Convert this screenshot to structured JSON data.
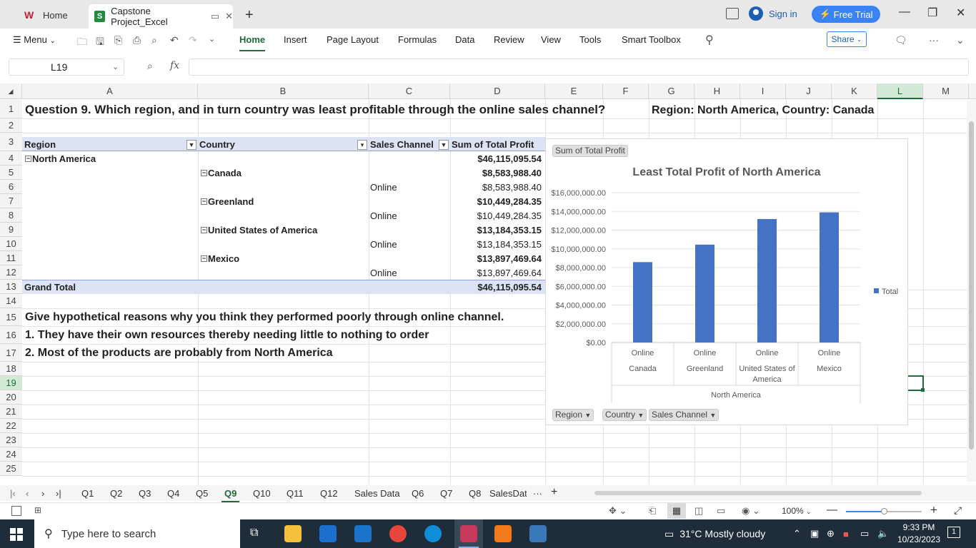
{
  "window": {
    "tabs": [
      {
        "label": "Home"
      },
      {
        "label": "Capstone Project_Excel"
      }
    ],
    "sign_in": "Sign in",
    "free_trial": "Free Trial"
  },
  "menu": {
    "menu_label": "Menu",
    "items": [
      "Home",
      "Insert",
      "Page Layout",
      "Formulas",
      "Data",
      "Review",
      "View",
      "Tools",
      "Smart Toolbox"
    ],
    "share": "Share"
  },
  "formula_bar": {
    "cell_ref": "L19",
    "fx": "fx",
    "value": ""
  },
  "columns": [
    "A",
    "B",
    "C",
    "D",
    "E",
    "F",
    "G",
    "H",
    "I",
    "J",
    "K",
    "L",
    "M"
  ],
  "rows": [
    "1",
    "2",
    "3",
    "4",
    "5",
    "6",
    "7",
    "8",
    "9",
    "10",
    "11",
    "12",
    "13",
    "14",
    "15",
    "16",
    "17",
    "18",
    "19",
    "20",
    "21",
    "22",
    "23",
    "24",
    "25"
  ],
  "selected": {
    "column": "L",
    "row": "19"
  },
  "sheet": {
    "question": "Question 9. Which region, and in turn country was least profitable through the online sales channel?",
    "answer": "Region: North America, Country: Canada",
    "pivot": {
      "headers": {
        "region": "Region",
        "country": "Country",
        "channel": "Sales Channel",
        "sum": "Sum of Total Profit"
      },
      "region": {
        "name": "North America",
        "total": "$46,115,095.54"
      },
      "countries": [
        {
          "name": "Canada",
          "total": "$8,583,988.40",
          "channel": "Online",
          "channel_total": "$8,583,988.40"
        },
        {
          "name": "Greenland",
          "total": "$10,449,284.35",
          "channel": "Online",
          "channel_total": "$10,449,284.35"
        },
        {
          "name": "United States of America",
          "total": "$13,184,353.15",
          "channel": "Online",
          "channel_total": "$13,184,353.15"
        },
        {
          "name": "Mexico",
          "total": "$13,897,469.64",
          "channel": "Online",
          "channel_total": "$13,897,469.64"
        }
      ],
      "grand_total_label": "Grand Total",
      "grand_total": "$46,115,095.54"
    },
    "notes": [
      "Give hypothetical reasons why you think they performed poorly through online channel.",
      "1. They have their own resources thereby needing little to nothing to order",
      "2. Most of the products are probably from North America"
    ]
  },
  "chart_data": {
    "type": "bar",
    "title": "Least Total Profit of North America",
    "field_button": "Sum of Total Profit",
    "categories": [
      "Canada",
      "Greenland",
      "United States of America",
      "Mexico"
    ],
    "category_labels": [
      {
        "channel": "Online",
        "country_lines": [
          "Canada"
        ]
      },
      {
        "channel": "Online",
        "country_lines": [
          "Greenland"
        ]
      },
      {
        "channel": "Online",
        "country_lines": [
          "United States of",
          "America"
        ]
      },
      {
        "channel": "Online",
        "country_lines": [
          "Mexico"
        ]
      }
    ],
    "group_label": "North America",
    "series": [
      {
        "name": "Total",
        "values": [
          8583988.4,
          10449284.35,
          13184353.15,
          13897469.64
        ]
      }
    ],
    "ylim": [
      0,
      16000000
    ],
    "yticks": [
      "$0.00",
      "$2,000,000.00",
      "$4,000,000.00",
      "$6,000,000.00",
      "$8,000,000.00",
      "$10,000,000.00",
      "$12,000,000.00",
      "$14,000,000.00",
      "$16,000,000.00"
    ],
    "ytick_values": [
      0,
      2000000,
      4000000,
      6000000,
      8000000,
      10000000,
      12000000,
      14000000,
      16000000
    ],
    "bar_color": "#4472c4",
    "legend_position": "right",
    "filter_buttons": [
      "Region",
      "Country",
      "Sales Channel"
    ]
  },
  "sheet_tabs": [
    "Q1",
    "Q2",
    "Q3",
    "Q4",
    "Q5",
    "Q9",
    "Q10",
    "Q11",
    "Q12",
    "Sales Data",
    "Q6",
    "Q7",
    "Q8",
    "SalesData..."
  ],
  "active_sheet": "Q9",
  "status": {
    "zoom": "100%"
  },
  "taskbar": {
    "search_placeholder": "Type here to search",
    "weather": "31°C  Mostly cloudy",
    "time": "9:33 PM",
    "date": "10/23/2023",
    "notifications": "1"
  }
}
